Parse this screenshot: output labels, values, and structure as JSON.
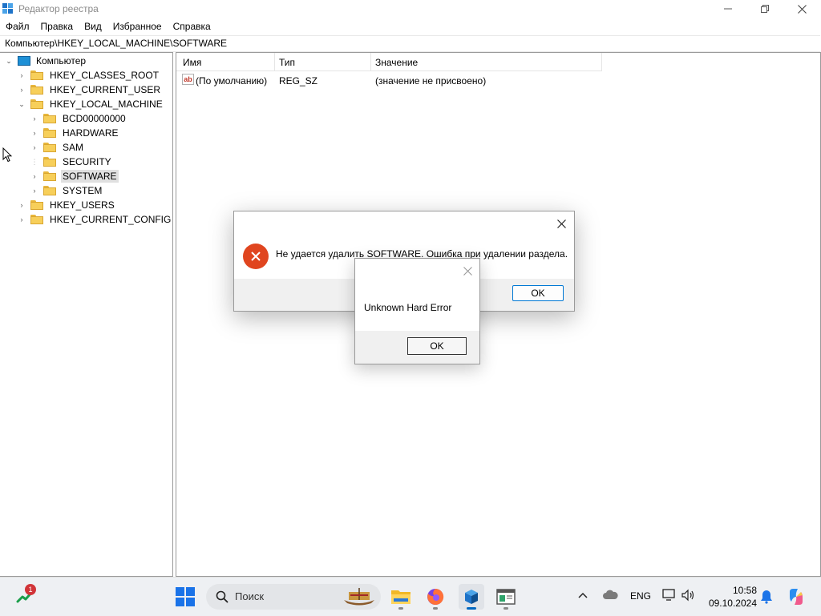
{
  "window": {
    "title": "Редактор реестра"
  },
  "menu": [
    "Файл",
    "Правка",
    "Вид",
    "Избранное",
    "Справка"
  ],
  "address": "Компьютер\\HKEY_LOCAL_MACHINE\\SOFTWARE",
  "tree": {
    "root": "Компьютер",
    "hives": [
      {
        "label": "HKEY_CLASSES_ROOT"
      },
      {
        "label": "HKEY_CURRENT_USER"
      },
      {
        "label": "HKEY_LOCAL_MACHINE",
        "expanded": true,
        "children": [
          "BCD00000000",
          "HARDWARE",
          "SAM",
          "SECURITY",
          "SOFTWARE",
          "SYSTEM"
        ]
      },
      {
        "label": "HKEY_USERS"
      },
      {
        "label": "HKEY_CURRENT_CONFIG"
      }
    ],
    "selected": "SOFTWARE"
  },
  "list": {
    "columns": [
      "Имя",
      "Тип",
      "Значение"
    ],
    "rows": [
      {
        "icon": "ab",
        "name": "(По умолчанию)",
        "type": "REG_SZ",
        "value": "(значение не присвоено)"
      }
    ]
  },
  "error_dialog": {
    "message": "Не удается удалить SOFTWARE.  Ошибка при удалении раздела.",
    "ok_label": "OK",
    "icon": "error-icon",
    "accent": "#e0451f"
  },
  "hard_error_dialog": {
    "message": "Unknown Hard Error",
    "ok_label": "OK"
  },
  "taskbar": {
    "widget_badge": "1",
    "search_placeholder": "Поиск",
    "apps": [
      "file-explorer-icon",
      "firefox-icon",
      "regedit-icon",
      "system-app-icon"
    ],
    "active_app": "regedit-icon",
    "language": "ENG",
    "time": "10:58",
    "date": "09.10.2024"
  }
}
